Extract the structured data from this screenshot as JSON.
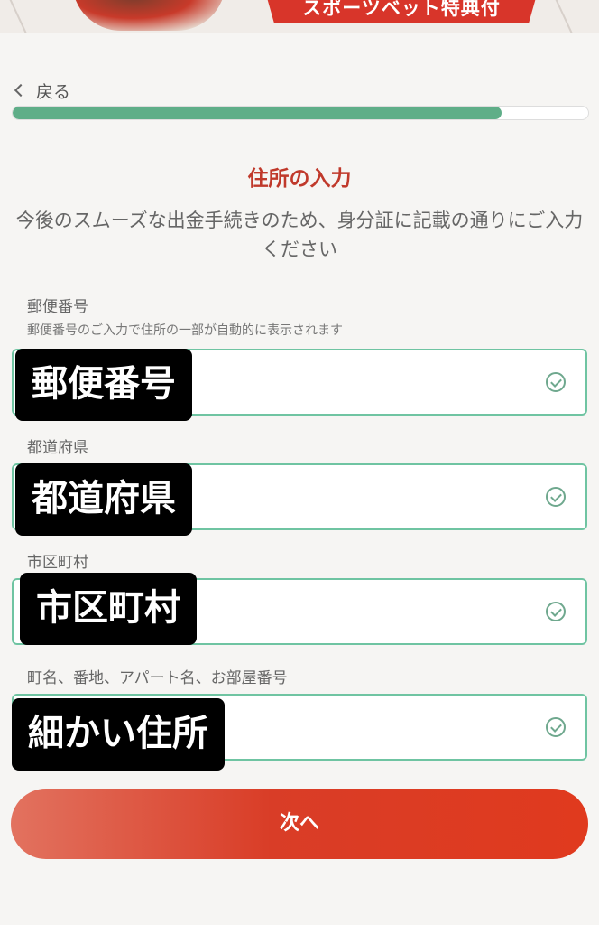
{
  "banner": {
    "ribbon_text": "スポーツベット特典付"
  },
  "nav": {
    "back_label": "戻る"
  },
  "progress": {
    "fraction": 0.85
  },
  "page": {
    "title": "住所の入力",
    "description": "今後のスムーズな出金手続きのため、身分証に記載の通りにご入力ください"
  },
  "fields": {
    "postal": {
      "label": "郵便番号",
      "hint": "郵便番号のご入力で住所の一部が自動的に表示されます",
      "overlay": "郵便番号"
    },
    "prefecture": {
      "label": "都道府県",
      "overlay": "都道府県"
    },
    "city": {
      "label": "市区町村",
      "overlay": "市区町村"
    },
    "street": {
      "label": "町名、番地、アパート名、お部屋番号",
      "overlay": "細かい住所"
    }
  },
  "actions": {
    "next_label": "次へ"
  },
  "colors": {
    "accent": "#c0392b",
    "progress": "#5fae88",
    "field_border": "#6fc4a2",
    "button": "#d93d27"
  },
  "icons": {
    "back": "chevron-left-icon",
    "valid": "check-circle-icon"
  }
}
